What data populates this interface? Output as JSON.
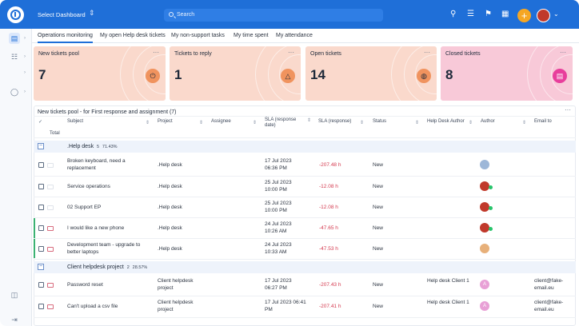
{
  "topbar": {
    "dashboard_select": "Select Dashboard",
    "search_placeholder": "Search",
    "colors": {
      "bar": "#1f6fd8",
      "plus": "#f5a623"
    }
  },
  "tabs": [
    {
      "label": "Operations monitoring",
      "active": true
    },
    {
      "label": "My open Help desk tickets",
      "active": false
    },
    {
      "label": "My non-support tasks",
      "active": false
    },
    {
      "label": "My time spent",
      "active": false
    },
    {
      "label": "My attendance",
      "active": false
    }
  ],
  "cards": [
    {
      "title": "New tickets pool",
      "value": "7",
      "icon": "alarm-icon",
      "color": "#fad9cc"
    },
    {
      "title": "Tickets to reply",
      "value": "1",
      "icon": "warning-icon",
      "color": "#fad9cc"
    },
    {
      "title": "Open tickets",
      "value": "14",
      "icon": "globe-icon",
      "color": "#fad9cc"
    },
    {
      "title": "Closed tickets",
      "value": "8",
      "icon": "list-icon",
      "color": "#f8c9d8"
    }
  ],
  "table": {
    "title": "New tickets pool - for First response and assignment (7)",
    "total_label": "Total",
    "headers": [
      "Subject",
      "Project",
      "Assignee",
      "SLA (response date)",
      "SLA (response)",
      "Status",
      "Help Desk Author",
      "Author",
      "Email to"
    ],
    "groups": [
      {
        "name": ".Help desk",
        "count": "5",
        "percent": "71.43%",
        "rows": [
          {
            "subject": "Broken keyboard, need a replacement",
            "project": ".Help desk",
            "sla_date": "17 Jul 2023 06:36 PM",
            "sla": "-207.48 h",
            "status": "New",
            "hd_author": "",
            "email": "",
            "mail_flag": false
          },
          {
            "subject": "Service operations",
            "project": ".Help desk",
            "sla_date": "25 Jul 2023 10:00 PM",
            "sla": "-12.08 h",
            "status": "New",
            "hd_author": "",
            "email": "",
            "mail_flag": false
          },
          {
            "subject": "02 Support EP",
            "project": ".Help desk",
            "sla_date": "25 Jul 2023 10:00 PM",
            "sla": "-12.08 h",
            "status": "New",
            "hd_author": "",
            "email": "",
            "mail_flag": false
          },
          {
            "subject": "I would like a new phone",
            "project": ".Help desk",
            "sla_date": "24 Jul 2023 10:26 AM",
            "sla": "-47.65 h",
            "status": "New",
            "hd_author": "",
            "email": "",
            "mail_flag": true
          },
          {
            "subject": "Development team - upgrade to better laptops",
            "project": ".Help desk",
            "sla_date": "24 Jul 2023 10:33 AM",
            "sla": "-47.53 h",
            "status": "New",
            "hd_author": "",
            "email": "",
            "mail_flag": true
          }
        ]
      },
      {
        "name": "Client helpdesk project",
        "count": "2",
        "percent": "28.57%",
        "rows": [
          {
            "subject": "Password reset",
            "project": "Client helpdesk project",
            "sla_date": "17 Jul 2023 06:27 PM",
            "sla": "-207.43 h",
            "status": "New",
            "hd_author": "Help desk Client 1",
            "email": "client@fake-email.eu",
            "avatar_letter": "A",
            "mail_flag": true
          },
          {
            "subject": "Can't upload a csv file",
            "project": "Client helpdesk project",
            "sla_date": "17 Jul 2023 06:41 PM",
            "sla": "-207.41 h",
            "status": "New",
            "hd_author": "Help desk Client 1",
            "email": "client@fake-email.eu",
            "avatar_letter": "A",
            "mail_flag": true
          }
        ]
      }
    ]
  }
}
